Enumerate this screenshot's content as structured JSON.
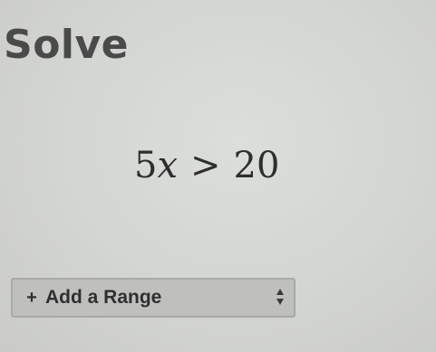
{
  "page": {
    "title": "Solve"
  },
  "equation": {
    "coefficient": "5",
    "variable": "x",
    "operator": ">",
    "constant": "20"
  },
  "add_range": {
    "icon": "plus-icon",
    "label": "Add a Range",
    "dropdown_icon": "updown-arrow-icon"
  }
}
